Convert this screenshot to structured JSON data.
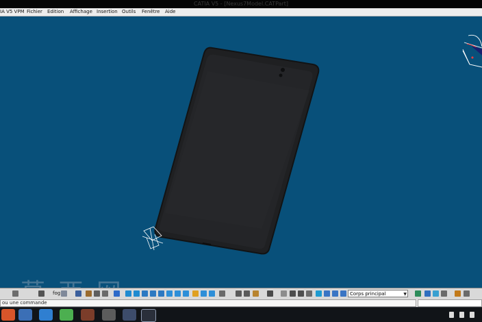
{
  "window": {
    "title": "CATIA V5 - [Nexus7Model.CATPart]"
  },
  "menu": {
    "app": "IA V5 VPM",
    "items": [
      {
        "label": "Fichier"
      },
      {
        "label": "Edition"
      },
      {
        "label": "Affichage"
      },
      {
        "label": "Insertion"
      },
      {
        "label": "Outils"
      },
      {
        "label": "Fenêtre"
      },
      {
        "label": "Aide"
      }
    ]
  },
  "toolbar": {
    "fog_label": "fog",
    "body_select": {
      "value": "Corps principal"
    }
  },
  "command": {
    "prompt": "ou une commande"
  },
  "watermark": {
    "text": "莫 西 网"
  },
  "colors": {
    "viewport_bg": "#08507a",
    "model_body": "#1f2022",
    "model_screen": "#26272a"
  },
  "icons": [
    "tablet-model",
    "axis-compass",
    "select-arrow-icon",
    "fog-icon",
    "pan-icon",
    "rotate-icon",
    "zoom-in-icon",
    "zoom-out-icon",
    "normal-view-icon",
    "multi-view-icon",
    "render-style-icon",
    "hide-show-icon",
    "swap-space-icon",
    "measure-icon",
    "material-icon",
    "body-select-dropdown"
  ]
}
